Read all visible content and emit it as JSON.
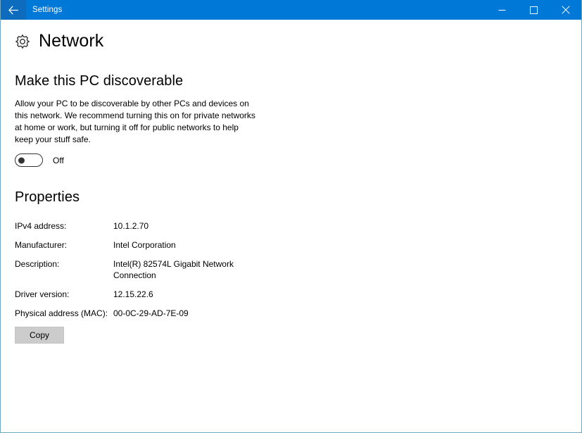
{
  "window": {
    "title": "Settings",
    "accent_color": "#0078d7",
    "back_icon": "back-arrow-icon",
    "controls": {
      "minimize": "minimize-icon",
      "maximize": "maximize-icon",
      "close": "close-icon"
    }
  },
  "page": {
    "icon": "gear-icon",
    "title": "Network"
  },
  "discoverable": {
    "heading": "Make this PC discoverable",
    "description": "Allow your PC to be discoverable by other PCs and devices on this network. We recommend turning this on for private networks at home or work, but turning it off for public networks to help keep your stuff safe.",
    "toggle_state": "Off",
    "toggle_on": false
  },
  "properties": {
    "heading": "Properties",
    "rows": [
      {
        "label": "IPv4 address:",
        "value": "10.1.2.70"
      },
      {
        "label": "Manufacturer:",
        "value": "Intel Corporation"
      },
      {
        "label": "Description:",
        "value": "Intel(R) 82574L Gigabit Network Connection"
      },
      {
        "label": "Driver version:",
        "value": "12.15.22.6"
      },
      {
        "label": "Physical address (MAC):",
        "value": "00-0C-29-AD-7E-09"
      }
    ],
    "copy_label": "Copy"
  }
}
